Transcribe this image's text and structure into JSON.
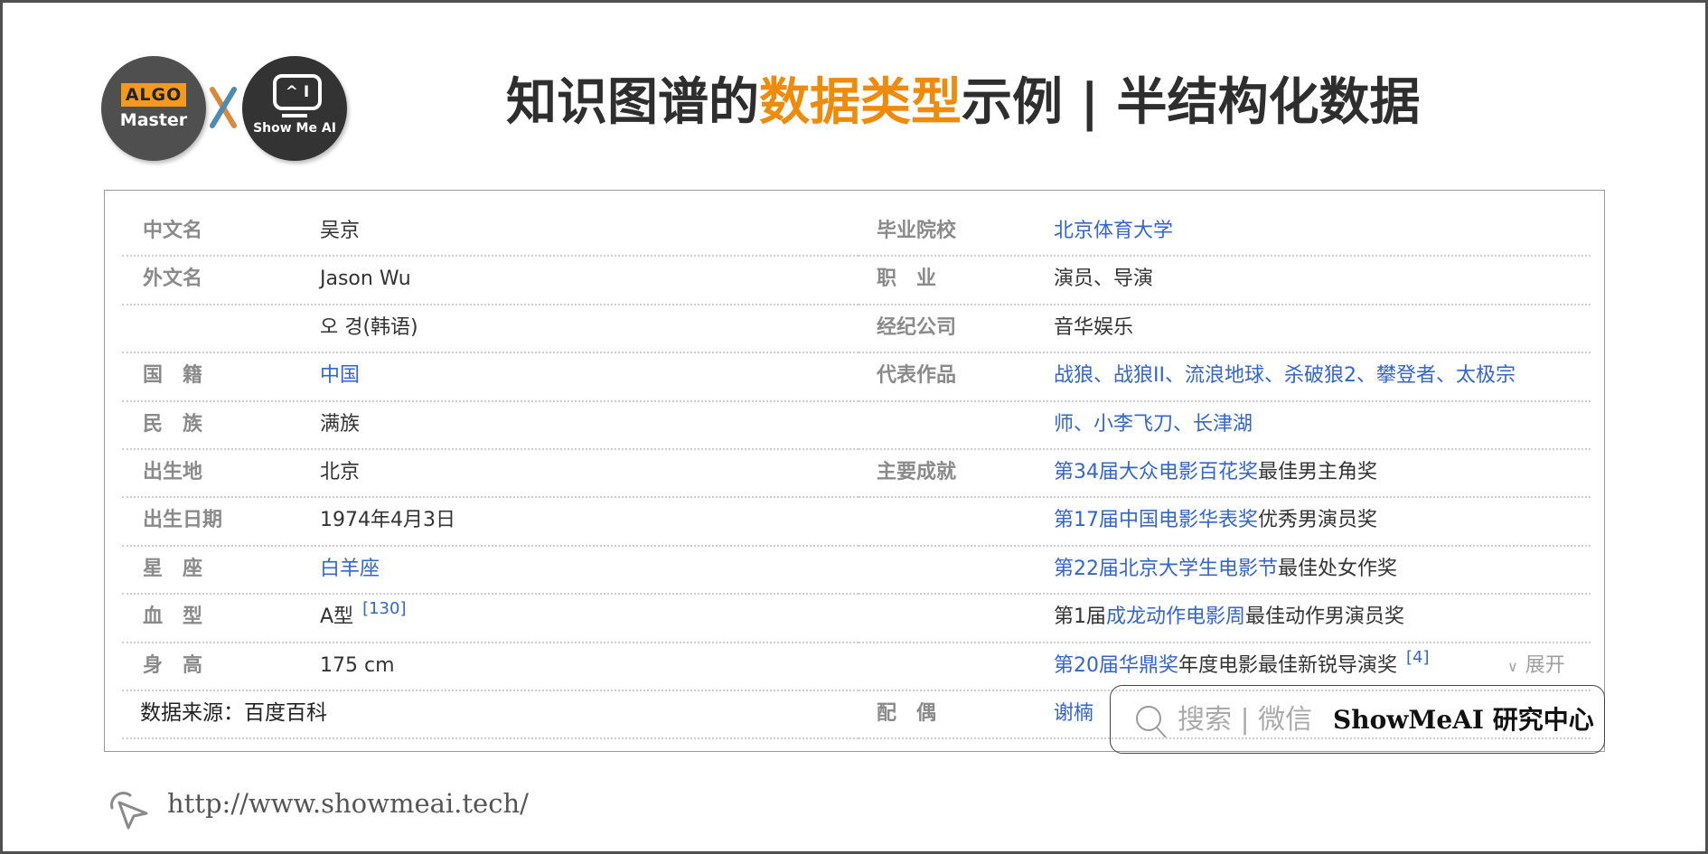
{
  "header": {
    "logo_left": {
      "badge": "ALGO",
      "name": "Master"
    },
    "logo_cross": "x",
    "logo_right": {
      "screen": "^ I",
      "name": "Show Me AI"
    },
    "title_prefix": "知识图谱的",
    "title_highlight": "数据类型",
    "title_suffix": "示例 | 半结构化数据",
    "highlight_color": "#ee8a0c"
  },
  "infobox": {
    "left": [
      {
        "label": "中文名",
        "value": [
          {
            "text": "吴京",
            "link": false
          }
        ]
      },
      {
        "label": "外文名",
        "value": [
          {
            "text": "Jason Wu",
            "link": false
          }
        ]
      },
      {
        "label": "",
        "value": [
          {
            "text": "오 경(韩语)",
            "link": false
          }
        ]
      },
      {
        "label": "国　籍",
        "value": [
          {
            "text": "中国",
            "link": true
          }
        ]
      },
      {
        "label": "民　族",
        "value": [
          {
            "text": "满族",
            "link": false
          }
        ]
      },
      {
        "label": "出生地",
        "value": [
          {
            "text": "北京",
            "link": false
          }
        ]
      },
      {
        "label": "出生日期",
        "value": [
          {
            "text": "1974年4月3日",
            "link": false
          }
        ]
      },
      {
        "label": "星　座",
        "value": [
          {
            "text": "白羊座",
            "link": true
          }
        ]
      },
      {
        "label": "血　型",
        "value": [
          {
            "text": "A型",
            "link": false
          }
        ],
        "ref": "[130]"
      },
      {
        "label": "身　高",
        "value": [
          {
            "text": "175 cm",
            "link": false
          }
        ]
      }
    ],
    "right": [
      {
        "label": "毕业院校",
        "value": [
          {
            "text": "北京体育大学",
            "link": true
          }
        ]
      },
      {
        "label": "职　业",
        "value": [
          {
            "text": "演员、导演",
            "link": false
          }
        ]
      },
      {
        "label": "经纪公司",
        "value": [
          {
            "text": "音华娱乐",
            "link": false
          }
        ]
      },
      {
        "label": "代表作品",
        "value": [
          {
            "text": "战狼、战狼II、流浪地球、杀破狼2、攀登者、太极宗",
            "link": true
          }
        ]
      },
      {
        "label": "",
        "value": [
          {
            "text": "师、小李飞刀、长津湖",
            "link": true
          }
        ]
      },
      {
        "label": "主要成就",
        "value": [
          {
            "text": "第34届大众电影百花奖",
            "link": true
          },
          {
            "text": "最佳男主角奖",
            "link": false
          }
        ]
      },
      {
        "label": "",
        "value": [
          {
            "text": "第17届中国电影华表奖",
            "link": true
          },
          {
            "text": "优秀男演员奖",
            "link": false
          }
        ]
      },
      {
        "label": "",
        "value": [
          {
            "text": "第22届北京大学生电影节",
            "link": true
          },
          {
            "text": "最佳处女作奖",
            "link": false
          }
        ]
      },
      {
        "label": "",
        "value": [
          {
            "text": "第1届",
            "link": false
          },
          {
            "text": "成龙动作电影周",
            "link": true
          },
          {
            "text": "最佳动作男演员奖",
            "link": false
          }
        ]
      },
      {
        "label": "",
        "value": [
          {
            "text": "第20届华鼎奖",
            "link": true
          },
          {
            "text": "年度电影最佳新锐导演奖",
            "link": false
          }
        ],
        "ref": "[4]",
        "expand": "展开"
      },
      {
        "label": "配　偶",
        "value": [
          {
            "text": "谢楠",
            "link": true
          }
        ]
      }
    ],
    "source": "数据来源：百度百科",
    "link_color": "#3366cc",
    "label_color": "#8a8a8a"
  },
  "badge": {
    "search_text": "搜索 | 微信",
    "brand_text": "ShowMeAI 研究中心"
  },
  "footer": {
    "url": "http://www.showmeai.tech/"
  }
}
